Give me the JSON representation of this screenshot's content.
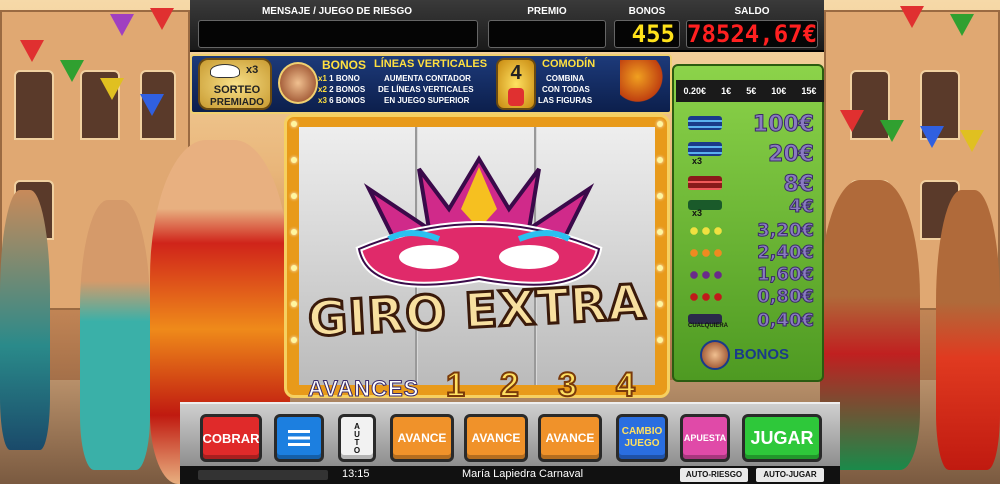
{
  "header": {
    "mensaje_label": "MENSAJE / JUEGO DE RIESGO",
    "premio_label": "PREMIO",
    "bonos_label": "BONOS",
    "saldo_label": "SALDO",
    "bonos_value": "455",
    "saldo_value": "78524,67€"
  },
  "info": {
    "sorteo_multiplier": "x3",
    "sorteo_text_1": "SORTEO",
    "sorteo_text_2": "PREMIADO",
    "bonos_title": "BONOS",
    "bonos_rows": [
      {
        "mult": "x1",
        "text": "1 BONO"
      },
      {
        "mult": "x2",
        "text": "2 BONOS"
      },
      {
        "mult": "x3",
        "text": "6 BONOS"
      }
    ],
    "lineas_title": "LÍNEAS VERTICALES",
    "lineas_text_1": "AUMENTA CONTADOR",
    "lineas_text_2": "DE LÍNEAS VERTICALES",
    "lineas_text_3": "EN JUEGO SUPERIOR",
    "lineas_number": "4",
    "comodin_title": "COMODÍN",
    "comodin_text_1": "COMBINA",
    "comodin_text_2": "CON TODAS",
    "comodin_text_3": "LAS FIGURAS"
  },
  "paytable": {
    "bets": [
      "0.20€",
      "1€",
      "5€",
      "10€",
      "15€"
    ],
    "rows": [
      {
        "value": "100€",
        "symbol": "bar-triple",
        "mult": ""
      },
      {
        "value": "20€",
        "symbol": "bar-triple",
        "mult": "x3"
      },
      {
        "value": "8€",
        "symbol": "bar-double",
        "mult": ""
      },
      {
        "value": "4€",
        "symbol": "bar-single",
        "mult": "x3"
      },
      {
        "value": "3,20€",
        "symbol": "lemons",
        "mult": ""
      },
      {
        "value": "2,40€",
        "symbol": "oranges",
        "mult": ""
      },
      {
        "value": "1,60€",
        "symbol": "grapes",
        "mult": ""
      },
      {
        "value": "0,80€",
        "symbol": "cherries",
        "mult": ""
      },
      {
        "value": "0,40€",
        "symbol": "any-bar",
        "mult": ""
      }
    ],
    "cualquiera_label": "CUALQUIERA",
    "bonos_label": "BONOS"
  },
  "overlay": {
    "title": "GIRO EXTRA"
  },
  "avances": {
    "label": "AVANCES",
    "numbers": [
      "1",
      "2",
      "3",
      "4"
    ]
  },
  "controls": {
    "cobrar": "COBRAR",
    "menu_icon": "menu-icon",
    "auto": "AUTO",
    "avance_1": "AVANCE",
    "avance_2": "AVANCE",
    "avance_3": "AVANCE",
    "cambio_juego_1": "CAMBIO",
    "cambio_juego_2": "JUEGO",
    "apuesta": "APUESTA",
    "jugar": "JUGAR"
  },
  "status": {
    "time": "13:15",
    "game_name": "María Lapiedra Carnaval",
    "auto_riesgo": "AUTO-RIESGO",
    "auto_jugar": "AUTO-JUGAR"
  },
  "colors": {
    "saldo_red": "#ff2020",
    "bonos_yellow": "#ffe21a",
    "paytable_green": "#6dbd36",
    "cobrar_red": "#e02a2a",
    "menu_blue": "#1c7fe0",
    "avance_orange": "#f0922a",
    "cambio_blue": "#2a6ee0",
    "apuesta_pink": "#e04aa8",
    "jugar_green": "#2ec83a"
  }
}
